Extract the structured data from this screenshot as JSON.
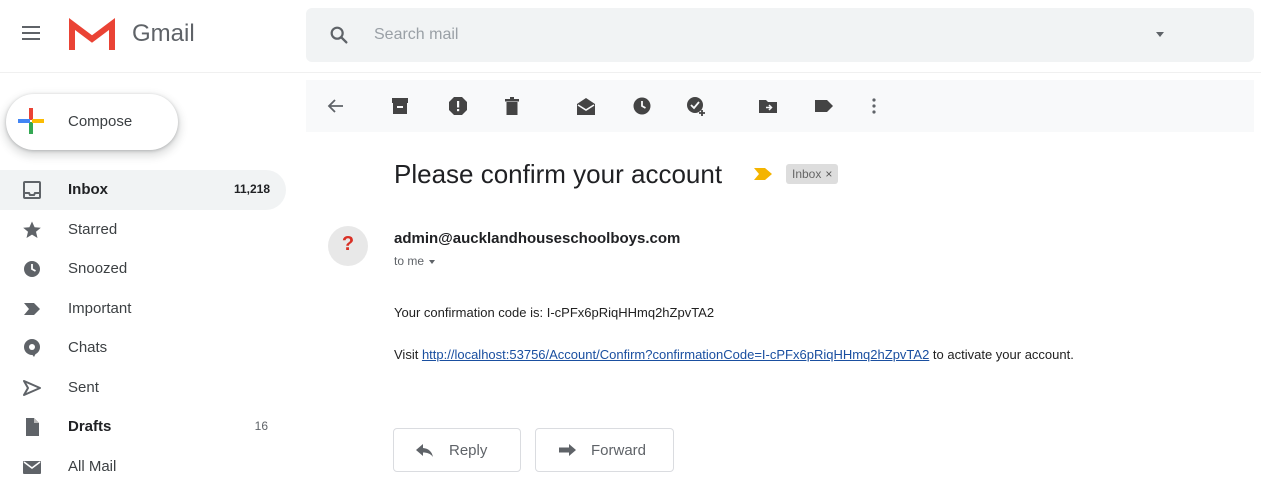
{
  "app": {
    "name": "Gmail"
  },
  "colors": {
    "accent_red": "#ea4335",
    "important_yellow": "#f4b400",
    "link_blue": "#1a4fa0"
  },
  "search": {
    "placeholder": "Search mail",
    "value": ""
  },
  "compose": {
    "label": "Compose"
  },
  "sidebar": {
    "items": [
      {
        "label": "Inbox",
        "count": "11,218",
        "icon": "inbox-icon",
        "active": true
      },
      {
        "label": "Starred",
        "count": "",
        "icon": "star-icon"
      },
      {
        "label": "Snoozed",
        "count": "",
        "icon": "clock-icon"
      },
      {
        "label": "Important",
        "count": "",
        "icon": "important-icon"
      },
      {
        "label": "Chats",
        "count": "",
        "icon": "chat-icon"
      },
      {
        "label": "Sent",
        "count": "",
        "icon": "send-icon"
      },
      {
        "label": "Drafts",
        "count": "16",
        "icon": "draft-icon"
      },
      {
        "label": "All Mail",
        "count": "",
        "icon": "mail-icon"
      }
    ]
  },
  "message": {
    "subject": "Please confirm your account",
    "label": "Inbox",
    "label_close": "×",
    "avatar_text": "?",
    "sender": "admin@aucklandhouseschoolboys.com",
    "recipient": "to me",
    "code_line": "Your confirmation code is: I-cPFx6pRiqHHmq2hZpvTA2",
    "visit_prefix": "Visit ",
    "link": "http://localhost:53756/Account/Confirm?confirmationCode=I-cPFx6pRiqHHmq2hZpvTA2",
    "visit_suffix": " to activate your account."
  },
  "actions": {
    "reply": "Reply",
    "forward": "Forward"
  }
}
